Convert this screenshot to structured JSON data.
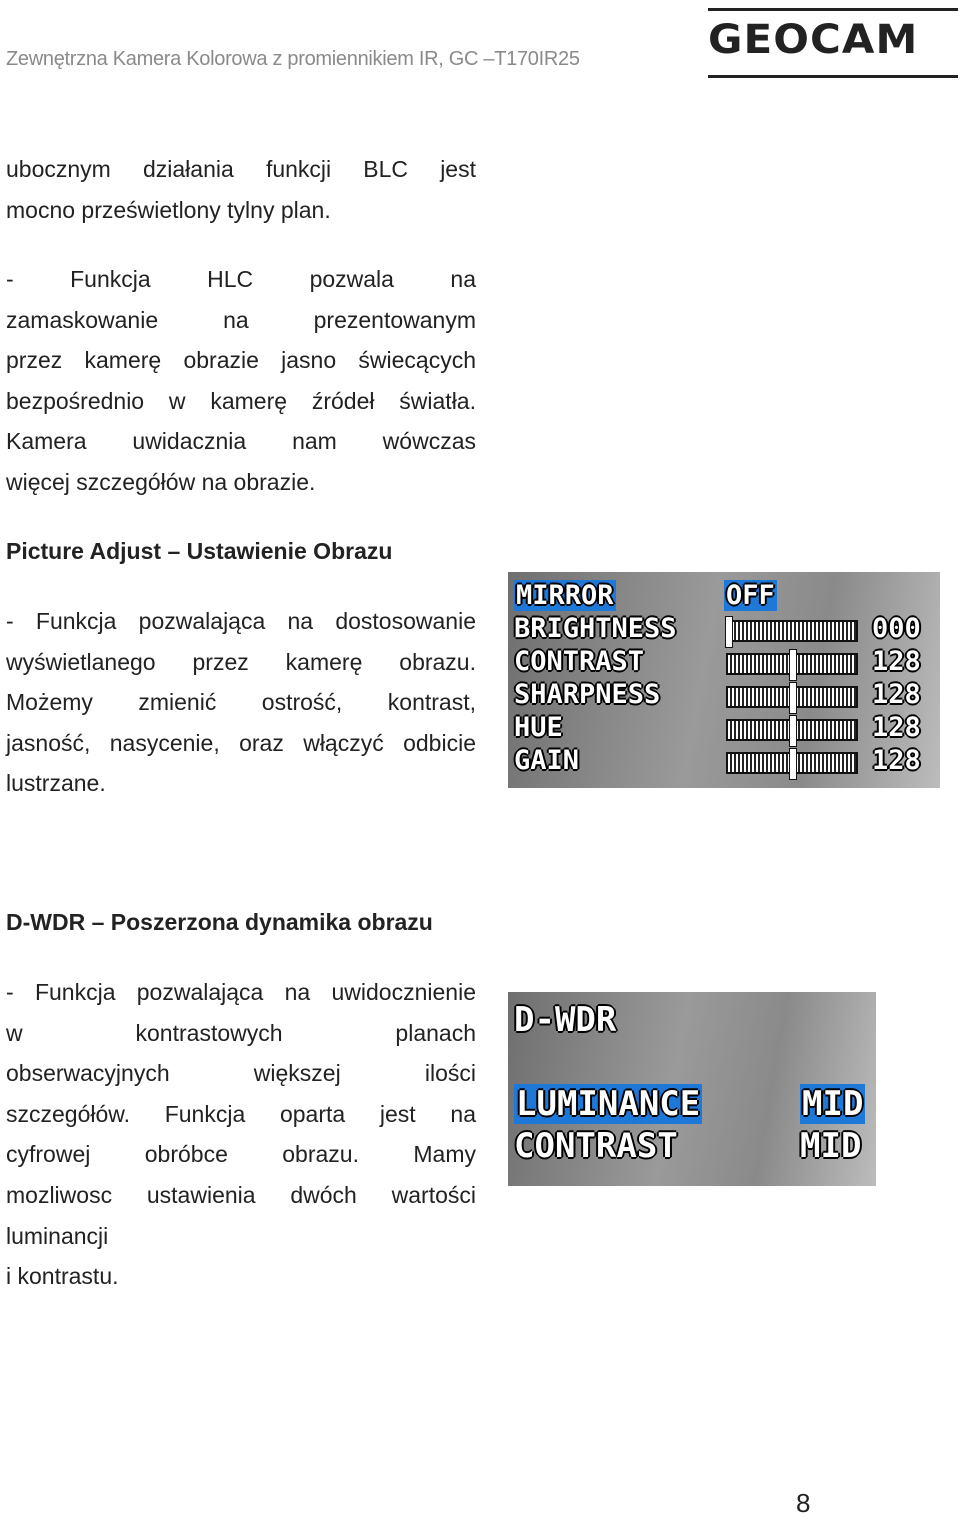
{
  "header": {
    "title": "Zewnętrzna Kamera Kolorowa z promiennikiem IR, GC –T170IR25",
    "logo": "GEOCAM"
  },
  "paragraphs": [
    {
      "lines": [
        "ubocznym działania funkcji BLC jest",
        "mocno prześwietlony tylny plan."
      ]
    },
    {
      "lines": [
        "- Funkcja HLC pozwala na",
        "zamaskowanie na prezentowanym",
        "przez kamerę obrazie jasno świecących",
        "bezpośrednio w kamerę źródeł światła.",
        "Kamera uwidacznia nam wówczas",
        "więcej szczegółów na obrazie."
      ]
    }
  ],
  "section1": {
    "heading": "Picture Adjust – Ustawienie Obrazu",
    "lines": [
      "- Funkcja pozwalająca na dostosowanie",
      "wyświetlanego przez kamerę obrazu.",
      "Możemy zmienić ostrość, kontrast,",
      "jasność, nasycenie, oraz włączyć odbicie",
      "lustrzane."
    ],
    "osd": {
      "rows": [
        {
          "label": "MIRROR",
          "value": "OFF",
          "selected": true
        },
        {
          "label": "BRIGHTNESS",
          "value": "000",
          "level": 0
        },
        {
          "label": "CONTRAST",
          "value": "128",
          "level": 0.5
        },
        {
          "label": "SHARPNESS",
          "value": "128",
          "level": 0.5
        },
        {
          "label": "HUE",
          "value": "128",
          "level": 0.5
        },
        {
          "label": "GAIN",
          "value": "128",
          "level": 0.5
        }
      ]
    }
  },
  "section2": {
    "heading": "D-WDR – Poszerzona dynamika obrazu",
    "lines": [
      "- Funkcja pozwalająca na uwidocznienie",
      "w kontrastowych planach",
      "obserwacyjnych większej ilości",
      "szczegółów. Funkcja oparta jest na",
      "cyfrowej obróbce obrazu. Mamy",
      "mozliwosc ustawienia dwóch wartości",
      "luminancji",
      "i kontrastu."
    ],
    "osd": {
      "title": "D-WDR",
      "rows": [
        {
          "label": "LUMINANCE",
          "value": "MID",
          "selected": true
        },
        {
          "label": "CONTRAST",
          "value": "MID"
        }
      ]
    }
  },
  "page_number": "8",
  "colors": {
    "highlight": "#1e78d8",
    "header_text": "#8a8a8a"
  }
}
